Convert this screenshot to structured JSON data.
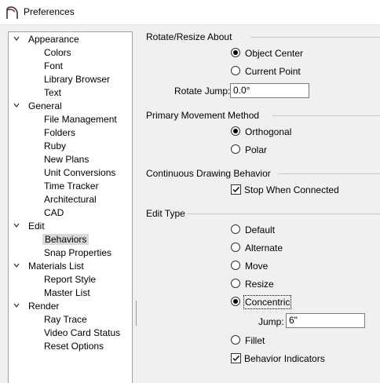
{
  "window": {
    "title": "Preferences"
  },
  "tree": {
    "items": [
      {
        "label": "Appearance",
        "expanded": true
      },
      {
        "label": "Colors"
      },
      {
        "label": "Font"
      },
      {
        "label": "Library Browser"
      },
      {
        "label": "Text"
      },
      {
        "label": "General",
        "expanded": true
      },
      {
        "label": "File Management"
      },
      {
        "label": "Folders"
      },
      {
        "label": "Ruby"
      },
      {
        "label": "New Plans"
      },
      {
        "label": "Unit Conversions"
      },
      {
        "label": "Time Tracker"
      },
      {
        "label": "Architectural"
      },
      {
        "label": "CAD"
      },
      {
        "label": "Edit",
        "expanded": true
      },
      {
        "label": "Behaviors",
        "selected": true
      },
      {
        "label": "Snap Properties"
      },
      {
        "label": "Materials List",
        "expanded": true
      },
      {
        "label": "Report Style"
      },
      {
        "label": "Master List"
      },
      {
        "label": "Render",
        "expanded": true
      },
      {
        "label": "Ray Trace"
      },
      {
        "label": "Video Card Status"
      },
      {
        "label": "Reset Options"
      }
    ]
  },
  "rotate_resize": {
    "header": "Rotate/Resize About",
    "object_center": "Object Center",
    "current_point": "Current Point",
    "selected": "Object Center",
    "rotate_jump_label": "Rotate Jump:",
    "rotate_jump_value": "0.0°"
  },
  "movement": {
    "header": "Primary Movement Method",
    "orthogonal": "Orthogonal",
    "polar": "Polar",
    "selected": "Orthogonal"
  },
  "continuous": {
    "header": "Continuous Drawing Behavior",
    "stop_when_connected": "Stop When Connected",
    "stop_when_connected_checked": true
  },
  "edit_type": {
    "header": "Edit Type",
    "default": "Default",
    "alternate": "Alternate",
    "move": "Move",
    "resize": "Resize",
    "concentric": "Concentric",
    "jump_label": "Jump:",
    "jump_value": "6\"",
    "fillet": "Fillet",
    "selected": "Concentric",
    "behavior_indicators": "Behavior Indicators",
    "behavior_indicators_checked": true
  }
}
